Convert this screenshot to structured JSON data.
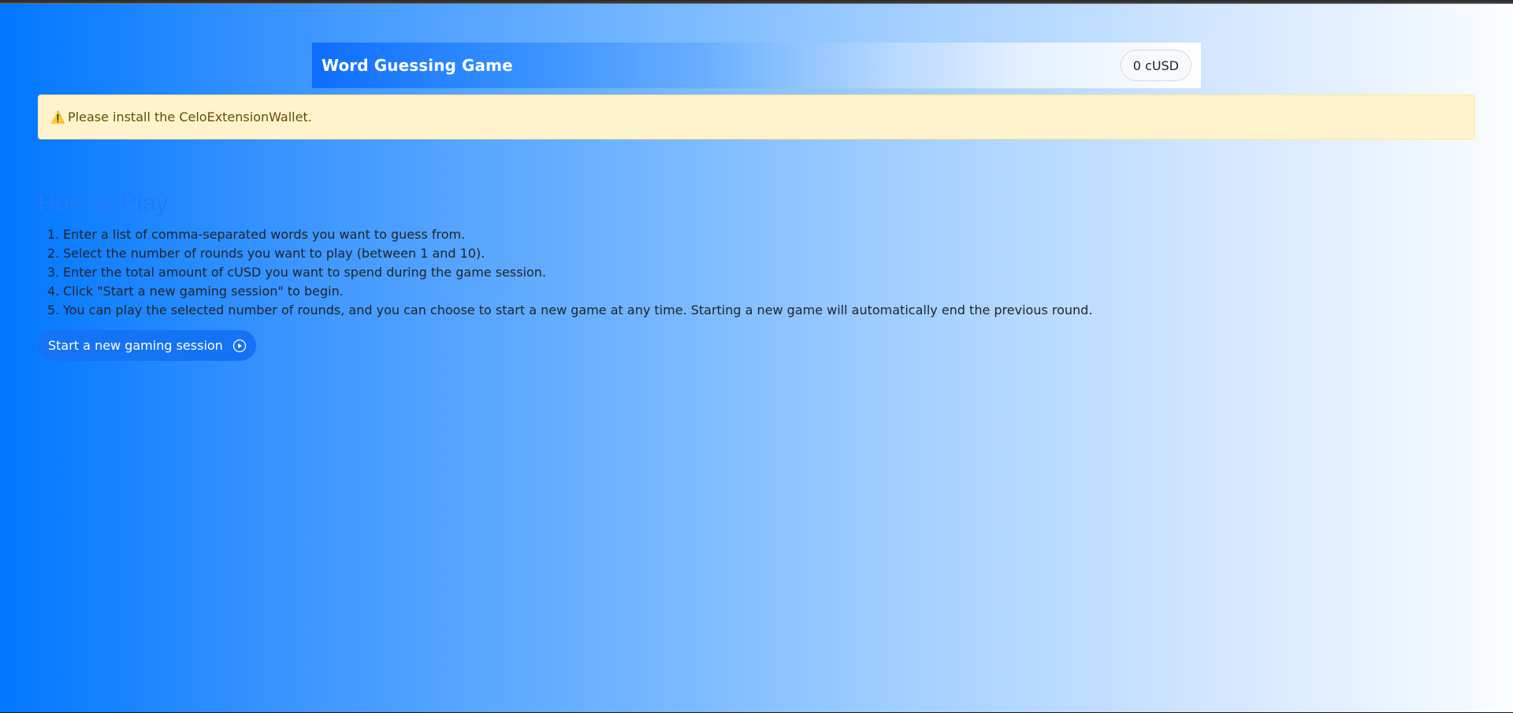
{
  "navbar": {
    "title": "Word Guessing Game",
    "balance": "0 cUSD"
  },
  "alert": {
    "icon": "warning-icon",
    "text": "Please install the CeloExtensionWallet."
  },
  "howto": {
    "title": "How to Play",
    "steps": [
      {
        "num": "1.",
        "text": "Enter a list of comma-separated words you want to guess from."
      },
      {
        "num": "2.",
        "text": "Select the number of rounds you want to play (between 1 and 10)."
      },
      {
        "num": "3.",
        "text": "Enter the total amount of cUSD you want to spend during the game session."
      },
      {
        "num": "4.",
        "text": "Click \"Start a new gaming session\" to begin."
      },
      {
        "num": "5.",
        "text": "You can play the selected number of rounds, and you can choose to start a new game at any time. Starting a new game will automatically end the previous round."
      }
    ]
  },
  "start_button": {
    "label": "Start a new gaming session",
    "icon": "play-circle-icon"
  },
  "colors": {
    "accent": "#0d6efd",
    "alert_bg": "#fff3cd",
    "alert_text": "#664d03"
  }
}
